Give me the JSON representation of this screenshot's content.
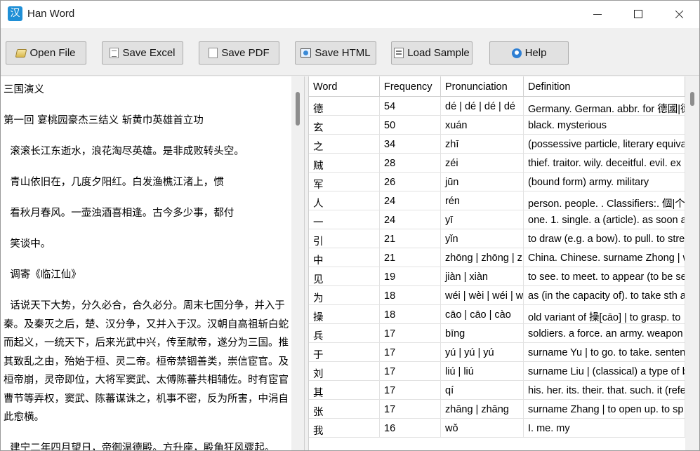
{
  "window": {
    "title": "Han Word",
    "app_icon_glyph": "汉"
  },
  "toolbar": {
    "open_file": "Open File",
    "save_excel": "Save Excel",
    "save_pdf": "Save PDF",
    "save_html": "Save HTML",
    "load_sample": "Load Sample",
    "help": "Help"
  },
  "text_panel": {
    "paragraphs": [
      "三国演义",
      "第一回 宴桃园豪杰三结义 斩黄巾英雄首立功",
      "  滚滚长江东逝水，浪花淘尽英雄。是非成败转头空。",
      "  青山依旧在，几度夕阳红。白发渔樵江渚上，惯",
      "  看秋月春风。一壶浊酒喜相逢。古今多少事，都付",
      "  笑谈中。",
      "  调寄《临江仙》",
      "  话说天下大势，分久必合，合久必分。周末七国分争，并入于秦。及秦灭之后，楚、汉分争，又并入于汉。汉朝自高祖斩白蛇而起义，一统天下，后来光武中兴，传至献帝，遂分为三国。推其致乱之由，殆始于桓、灵二帝。桓帝禁锢善类，崇信宦官。及桓帝崩，灵帝即位，大将军窦武、太傅陈蕃共相辅佐。时有宦官曹节等弄权，窦武、陈蕃谋诛之，机事不密，反为所害，中涓自此愈横。",
      "  建宁二年四月望日，帝御温德殿。方升座，殿角狂风骤起。"
    ]
  },
  "table": {
    "columns": [
      "Word",
      "Frequency",
      "Pronunciation",
      "Definition"
    ],
    "rows": [
      [
        "德",
        "54",
        "dé | dé | dé | dé",
        "Germany. German. abbr. for 德國|德"
      ],
      [
        "玄",
        "50",
        "xuán",
        "black. mysterious"
      ],
      [
        "之",
        "34",
        "zhī",
        "(possessive particle, literary equiva"
      ],
      [
        "贼",
        "28",
        "zéi",
        "thief. traitor. wily. deceitful. evil. ex"
      ],
      [
        "军",
        "26",
        "jūn",
        "(bound form) army. military"
      ],
      [
        "人",
        "24",
        "rén",
        "person. people. . Classifiers:. 個|个|"
      ],
      [
        "一",
        "24",
        "yī",
        "one. 1. single. a (article). as soon a"
      ],
      [
        "引",
        "21",
        "yǐn",
        "to draw (e.g. a bow). to pull. to stre"
      ],
      [
        "中",
        "21",
        "zhōng | zhōng | z",
        "China. Chinese. surname Zhong | w"
      ],
      [
        "见",
        "19",
        "jiàn | xiàn",
        "to see. to meet. to appear (to be se"
      ],
      [
        "为",
        "18",
        "wéi | wèi | wéi | w",
        "as (in the capacity of). to take sth a"
      ],
      [
        "操",
        "18",
        "cāo | cāo | cào",
        "old variant of 操[cāo] | to grasp. to"
      ],
      [
        "兵",
        "17",
        "bīng",
        "soldiers. a force. an army. weapon"
      ],
      [
        "于",
        "17",
        "yú | yú | yú",
        "surname Yu | to go. to take. senten"
      ],
      [
        "刘",
        "17",
        "liú | liú",
        "surname Liu | (classical) a type of b"
      ],
      [
        "其",
        "17",
        "qí",
        "his. her. its. their. that. such. it (refe"
      ],
      [
        "张",
        "17",
        "zhāng | zhāng",
        "surname Zhang | to open up. to sp"
      ],
      [
        "我",
        "16",
        "wǒ",
        "I. me. my"
      ]
    ]
  }
}
